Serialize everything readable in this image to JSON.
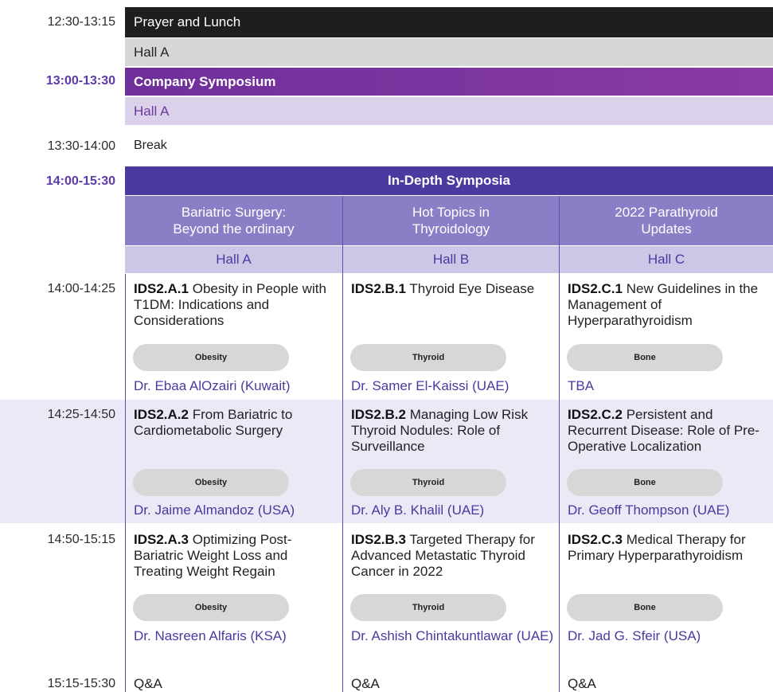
{
  "schedule": {
    "prayer": {
      "time": "12:30-13:15",
      "title": "Prayer and Lunch",
      "hall": "Hall A"
    },
    "symposium": {
      "time": "13:00-13:30",
      "title": "Company Symposium",
      "hall": "Hall A"
    },
    "break": {
      "time": "13:30-14:00",
      "title": "Break"
    },
    "ids": {
      "time": "14:00-15:30",
      "title": "In-Depth Symposia",
      "tracks": [
        {
          "title_line1": "Bariatric Surgery:",
          "title_line2": "Beyond the ordinary",
          "hall": "Hall A"
        },
        {
          "title_line1": "Hot Topics in",
          "title_line2": "Thyroidology",
          "hall": "Hall B"
        },
        {
          "title_line1": "2022 Parathyroid",
          "title_line2": "Updates",
          "hall": "Hall C"
        }
      ],
      "slots": [
        {
          "time": "14:00-14:25",
          "talks": [
            {
              "code": "IDS2.A.1",
              "title": "Obesity in People with T1DM: Indications and Considerations",
              "tag": "Obesity",
              "speaker": "Dr. Ebaa AlOzairi (Kuwait)"
            },
            {
              "code": "IDS2.B.1",
              "title": "Thyroid Eye Disease",
              "tag": "Thyroid",
              "speaker": "Dr. Samer El-Kaissi (UAE)"
            },
            {
              "code": "IDS2.C.1",
              "title": "New Guidelines in the Management of Hyperparathyroidism",
              "tag": "Bone",
              "speaker": "TBA"
            }
          ]
        },
        {
          "time": "14:25-14:50",
          "talks": [
            {
              "code": "IDS2.A.2",
              "title": "From Bariatric to Cardiometabolic Surgery",
              "tag": "Obesity",
              "speaker": "Dr. Jaime Almandoz (USA)"
            },
            {
              "code": "IDS2.B.2",
              "title": "Managing Low Risk Thyroid Nodules: Role of Surveillance",
              "tag": "Thyroid",
              "speaker": "Dr. Aly B. Khalil (UAE)"
            },
            {
              "code": "IDS2.C.2",
              "title": "Persistent and Recurrent Disease: Role of Pre-Operative Localization",
              "tag": "Bone",
              "speaker": "Dr. Geoff Thompson (UAE)"
            }
          ]
        },
        {
          "time": "14:50-15:15",
          "talks": [
            {
              "code": "IDS2.A.3",
              "title": "Optimizing Post-Bariatric Weight Loss and Treating Weight Regain",
              "tag": "Obesity",
              "speaker": "Dr. Nasreen Alfaris (KSA)"
            },
            {
              "code": "IDS2.B.3",
              "title": "Targeted Therapy for Advanced Metastatic Thyroid Cancer in 2022",
              "tag": "Thyroid",
              "speaker": "Dr. Ashish Chintakuntlawar (UAE)"
            },
            {
              "code": "IDS2.C.3",
              "title": "Medical Therapy for Primary Hyperparathyroidism",
              "tag": "Bone",
              "speaker": "Dr. Jad G. Sfeir (USA)"
            }
          ]
        }
      ],
      "qa": {
        "time": "15:15-15:30",
        "label": "Q&A"
      }
    }
  }
}
